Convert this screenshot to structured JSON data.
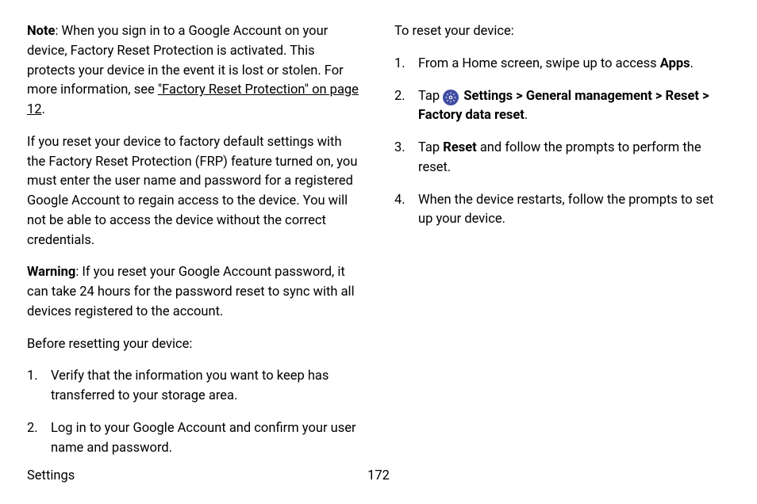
{
  "left": {
    "note_label": "Note",
    "note_text": ": When you sign in to a Google Account on your device, Factory Reset Protection is activated. This protects your device in the event it is lost or stolen. For more information, see ",
    "note_link": "\"Factory Reset Protection\" on page 12",
    "note_period": ".",
    "frp_para": "If you reset your device to factory default settings with the Factory Reset Protection (FRP) feature turned on, you must enter the user name and password for a registered Google Account to regain access to the device. You will not be able to access the device without the correct credentials.",
    "warning_label": "Warning",
    "warning_text": ": If you reset your Google Account password, it can take 24 hours for the password reset to sync with all devices registered to the account.",
    "before_reset": "Before resetting your device:",
    "before_items": [
      "Verify that the information you want to keep has transferred to your storage area.",
      "Log in to your Google Account and confirm your user name and password."
    ]
  },
  "right": {
    "to_reset": "To reset your device:",
    "step1_a": "From a Home screen, swipe up to access ",
    "step1_b": "Apps",
    "step1_c": ".",
    "step2_a": "Tap ",
    "step2_b": "Settings",
    "step2_c": "General management",
    "step2_d": "Reset",
    "step2_e": "Factory data reset",
    "step2_f": ".",
    "chev": ">",
    "step3_a": "Tap ",
    "step3_b": "Reset",
    "step3_c": " and follow the prompts to perform the reset.",
    "step4": "When the device restarts, follow the prompts to set up your device."
  },
  "footer": {
    "section": "Settings",
    "page": "172"
  }
}
